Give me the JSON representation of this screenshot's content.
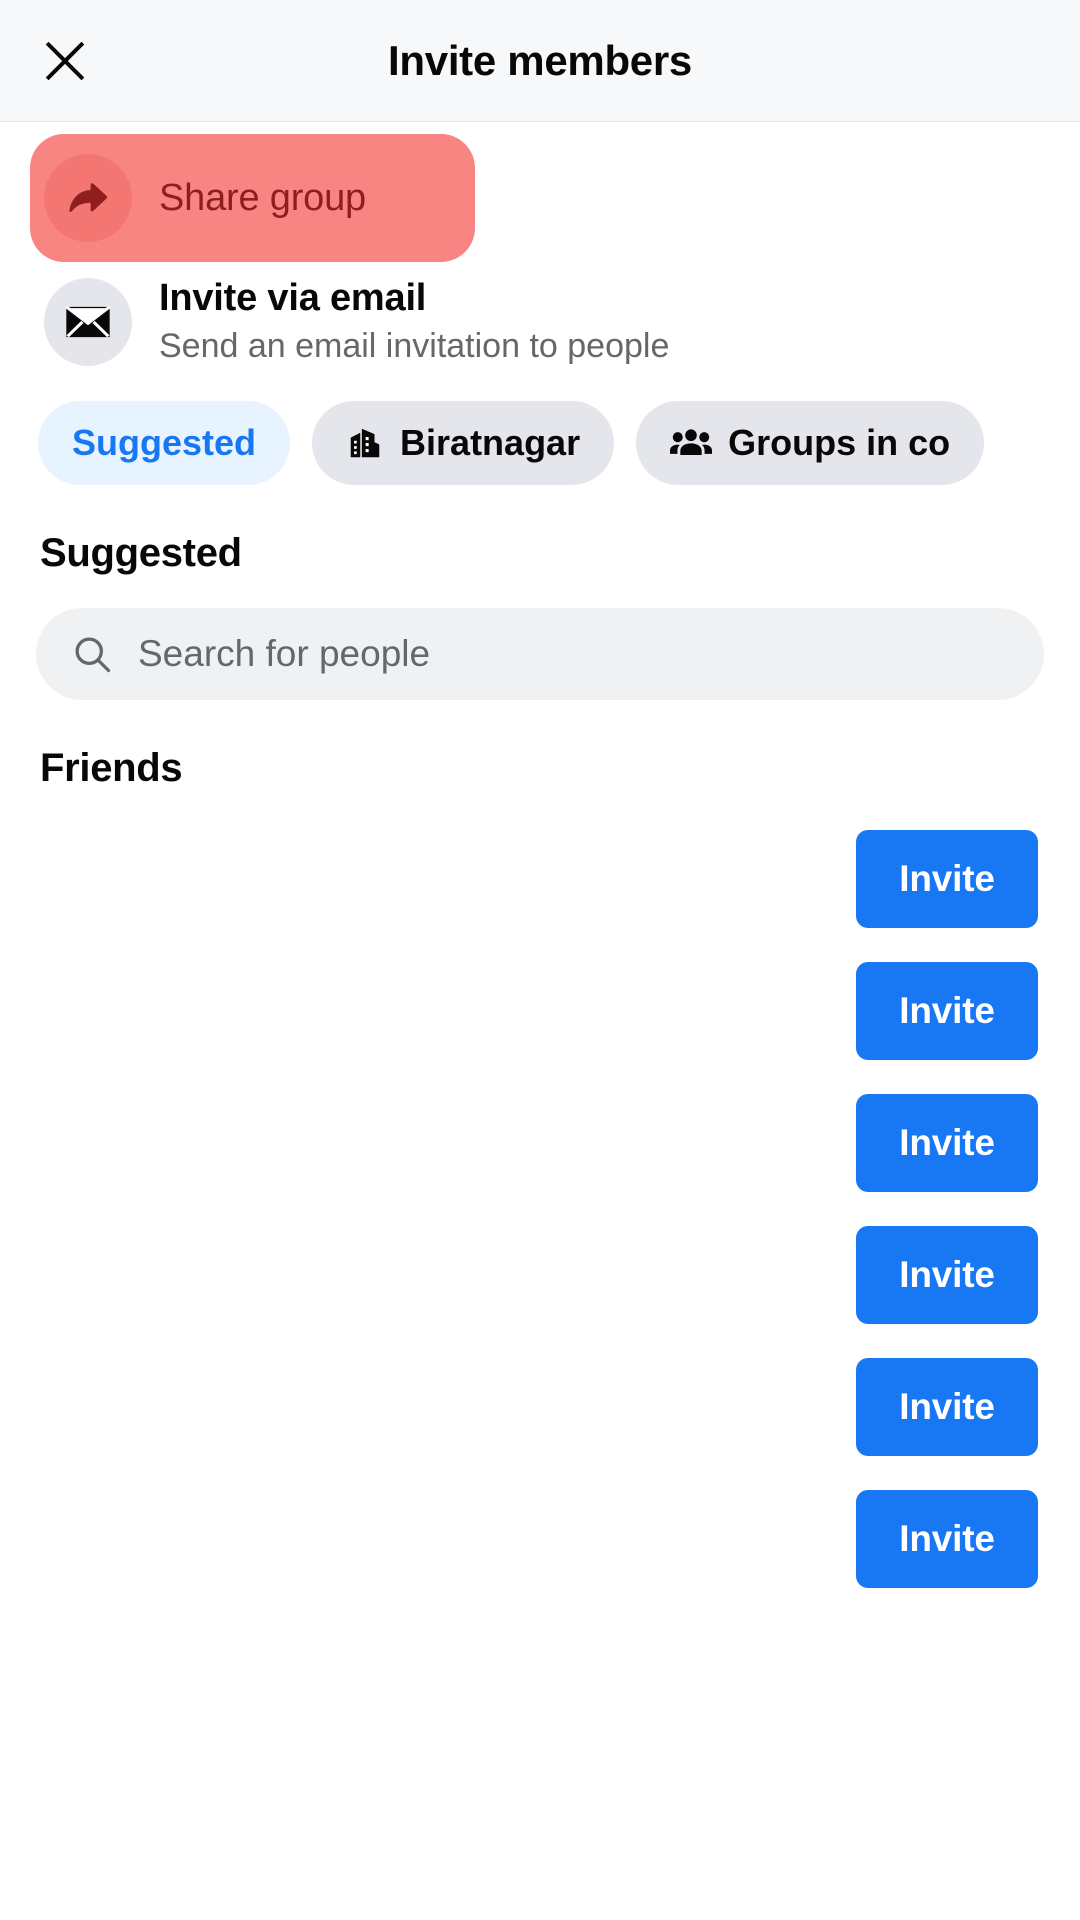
{
  "header": {
    "title": "Invite members",
    "close_icon": "close-icon"
  },
  "actions": [
    {
      "icon": "share-arrow-icon",
      "title": "Share group",
      "subtitle": "",
      "highlighted": true,
      "highlight_color": "#f98583",
      "highlight_text_color": "#8f1f1f"
    },
    {
      "icon": "envelope-icon",
      "title": "Invite via email",
      "subtitle": "Send an email invitation to people",
      "highlighted": false
    }
  ],
  "chips": [
    {
      "label": "Suggested",
      "icon": null,
      "active": true
    },
    {
      "label": "Biratnagar",
      "icon": "building-icon",
      "active": false
    },
    {
      "label": "Groups in co",
      "icon": "people-group-icon",
      "active": false
    }
  ],
  "suggested_section": {
    "heading": "Suggested"
  },
  "search": {
    "icon": "search-icon",
    "placeholder": "Search for people",
    "value": ""
  },
  "friends_section": {
    "heading": "Friends",
    "invite_label": "Invite",
    "rows": [
      {
        "name": "",
        "invite_label": "Invite"
      },
      {
        "name": "",
        "invite_label": "Invite"
      },
      {
        "name": "",
        "invite_label": "Invite"
      },
      {
        "name": "",
        "invite_label": "Invite"
      },
      {
        "name": "",
        "invite_label": "Invite"
      },
      {
        "name": "",
        "invite_label": "Invite"
      }
    ]
  },
  "colors": {
    "accent_blue": "#1877f2",
    "chip_active_bg": "#e7f3ff",
    "chip_bg": "#e4e6eb",
    "header_bg": "#f7f8fa",
    "search_bg": "#eff1f3",
    "highlight_coral": "#f98583",
    "text_primary": "#080809",
    "text_secondary": "#65676b"
  }
}
